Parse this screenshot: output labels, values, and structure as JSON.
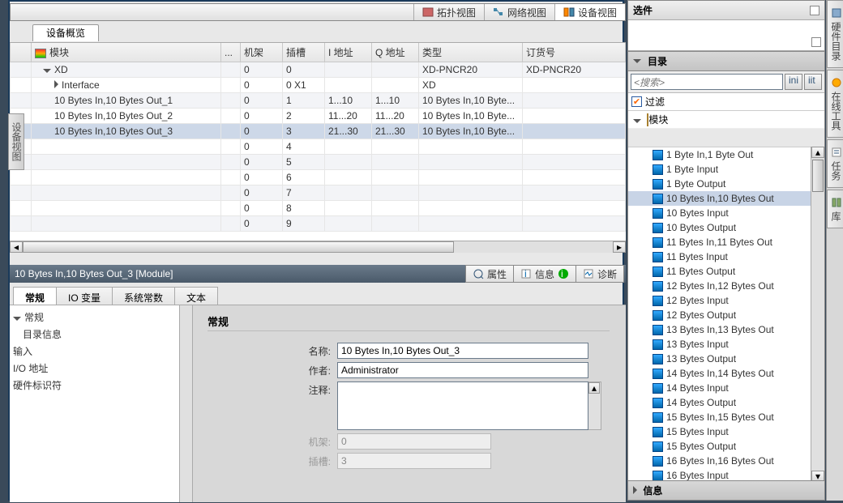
{
  "topbar": {
    "title": ""
  },
  "view_tabs": {
    "topology": "拓扑视图",
    "network": "网络视图",
    "device": "设备视图"
  },
  "left_side_label": "设备视图",
  "device_overview_tab": "设备概览",
  "table": {
    "headers": {
      "module": "模块",
      "dots": "...",
      "rack": "机架",
      "slot": "插槽",
      "iaddr": "I 地址",
      "qaddr": "Q 地址",
      "type": "类型",
      "order": "订货号"
    },
    "rows": [
      {
        "module": "XD",
        "rack": "0",
        "slot": "0",
        "iaddr": "",
        "qaddr": "",
        "type": "XD-PNCR20",
        "order": "XD-PNCR20",
        "level": 1,
        "expander": "down"
      },
      {
        "module": "Interface",
        "rack": "0",
        "slot": "0 X1",
        "iaddr": "",
        "qaddr": "",
        "type": "XD",
        "order": "",
        "level": 2,
        "expander": "right"
      },
      {
        "module": "10 Bytes In,10 Bytes Out_1",
        "rack": "0",
        "slot": "1",
        "iaddr": "1...10",
        "qaddr": "1...10",
        "type": "10 Bytes In,10 Byte...",
        "order": "",
        "level": 2
      },
      {
        "module": "10 Bytes In,10 Bytes Out_2",
        "rack": "0",
        "slot": "2",
        "iaddr": "11...20",
        "qaddr": "11...20",
        "type": "10 Bytes In,10 Byte...",
        "order": "",
        "level": 2
      },
      {
        "module": "10 Bytes In,10 Bytes Out_3",
        "rack": "0",
        "slot": "3",
        "iaddr": "21...30",
        "qaddr": "21...30",
        "type": "10 Bytes In,10 Byte...",
        "order": "",
        "level": 2,
        "selected": true
      },
      {
        "module": "",
        "rack": "0",
        "slot": "4",
        "iaddr": "",
        "qaddr": "",
        "type": "",
        "order": "",
        "level": 2
      },
      {
        "module": "",
        "rack": "0",
        "slot": "5",
        "iaddr": "",
        "qaddr": "",
        "type": "",
        "order": "",
        "level": 2
      },
      {
        "module": "",
        "rack": "0",
        "slot": "6",
        "iaddr": "",
        "qaddr": "",
        "type": "",
        "order": "",
        "level": 2
      },
      {
        "module": "",
        "rack": "0",
        "slot": "7",
        "iaddr": "",
        "qaddr": "",
        "type": "",
        "order": "",
        "level": 2
      },
      {
        "module": "",
        "rack": "0",
        "slot": "8",
        "iaddr": "",
        "qaddr": "",
        "type": "",
        "order": "",
        "level": 2
      },
      {
        "module": "",
        "rack": "0",
        "slot": "9",
        "iaddr": "",
        "qaddr": "",
        "type": "",
        "order": "",
        "level": 2
      }
    ]
  },
  "prop_title": "10 Bytes In,10 Bytes Out_3 [Module]",
  "prop_tabs": {
    "properties": "属性",
    "info": "信息",
    "diag": "诊断"
  },
  "lower_tabs": {
    "general": "常规",
    "io": "IO 变量",
    "sysconst": "系统常数",
    "text": "文本"
  },
  "nav": {
    "general": "常规",
    "cataloginfo": "目录信息",
    "input": "输入",
    "ioaddr": "I/O 地址",
    "hwid": "硬件标识符"
  },
  "form": {
    "heading": "常规",
    "name_label": "名称:",
    "name_value": "10 Bytes In,10 Bytes Out_3",
    "author_label": "作者:",
    "author_value": "Administrator",
    "comment_label": "注释:",
    "comment_value": "",
    "rack_label": "机架:",
    "rack_value": "0",
    "slot_label": "插槽:",
    "slot_value": "3"
  },
  "right": {
    "options_title": "选件",
    "catalog_title": "目录",
    "search_placeholder": "<搜索>",
    "filter_label": "过滤",
    "module_root": "模块",
    "items": [
      "1 Byte In,1 Byte Out",
      "1 Byte Input",
      "1 Byte Output",
      "10 Bytes In,10 Bytes Out",
      "10 Bytes Input",
      "10 Bytes Output",
      "11 Bytes In,11 Bytes Out",
      "11 Bytes Input",
      "11 Bytes Output",
      "12 Bytes In,12 Bytes Out",
      "12 Bytes Input",
      "12 Bytes Output",
      "13 Bytes In,13 Bytes Out",
      "13 Bytes Input",
      "13 Bytes Output",
      "14 Bytes In,14 Bytes Out",
      "14 Bytes Input",
      "14 Bytes Output",
      "15 Bytes In,15 Bytes Out",
      "15 Bytes Input",
      "15 Bytes Output",
      "16 Bytes In,16 Bytes Out",
      "16 Bytes Input"
    ],
    "selected_index": 3,
    "info_title": "信息"
  },
  "far_tabs": {
    "hwcat": "硬件目录",
    "online": "在线工具",
    "tasks": "任务",
    "lib": "库"
  }
}
